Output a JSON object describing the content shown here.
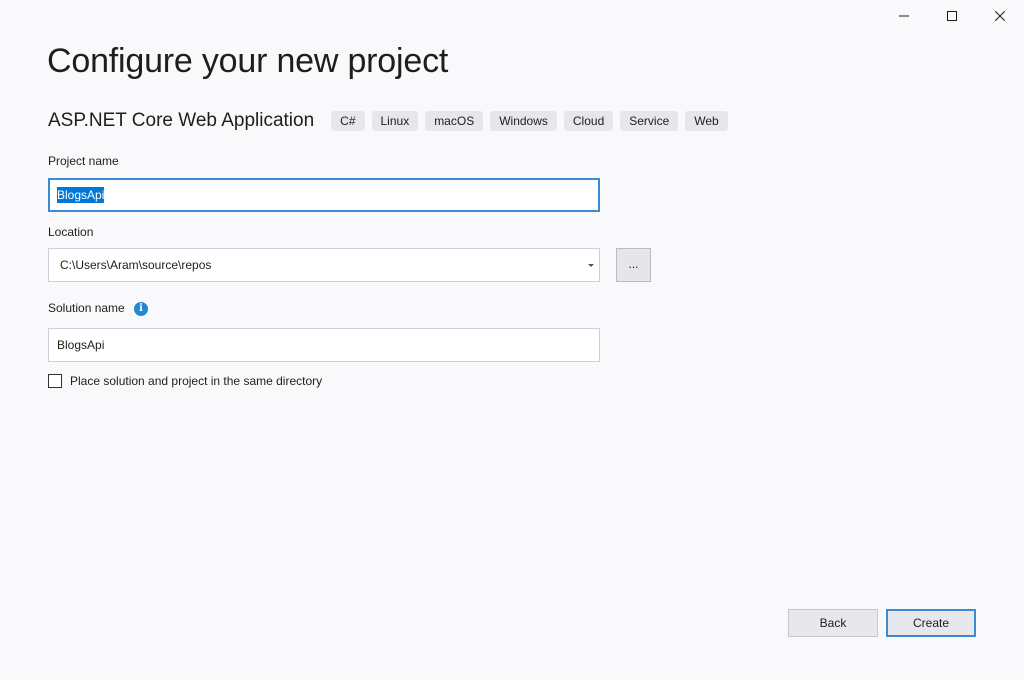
{
  "window": {
    "controls": [
      "minimize",
      "maximize",
      "close"
    ]
  },
  "page": {
    "title": "Configure your new project",
    "template_name": "ASP.NET Core Web Application",
    "tags": [
      "C#",
      "Linux",
      "macOS",
      "Windows",
      "Cloud",
      "Service",
      "Web"
    ]
  },
  "form": {
    "project_name": {
      "label": "Project name",
      "value": "BlogsApi"
    },
    "location": {
      "label": "Location",
      "value": "C:\\Users\\Aram\\source\\repos",
      "browse_label": "..."
    },
    "solution_name": {
      "label": "Solution name",
      "value": "BlogsApi",
      "info_glyph": "i"
    },
    "same_directory": {
      "label": "Place solution and project in the same directory",
      "checked": false
    }
  },
  "footer": {
    "back_label": "Back",
    "create_label": "Create"
  },
  "colors": {
    "accent": "#0078d7",
    "focus_border": "#3a8ad6",
    "info": "#1e8ad6",
    "background": "#f9f9fb"
  },
  "icons": {
    "minimize": "minimize-icon",
    "maximize": "maximize-icon",
    "close": "close-icon",
    "dropdown": "chevron-down-icon",
    "info": "info-icon"
  }
}
